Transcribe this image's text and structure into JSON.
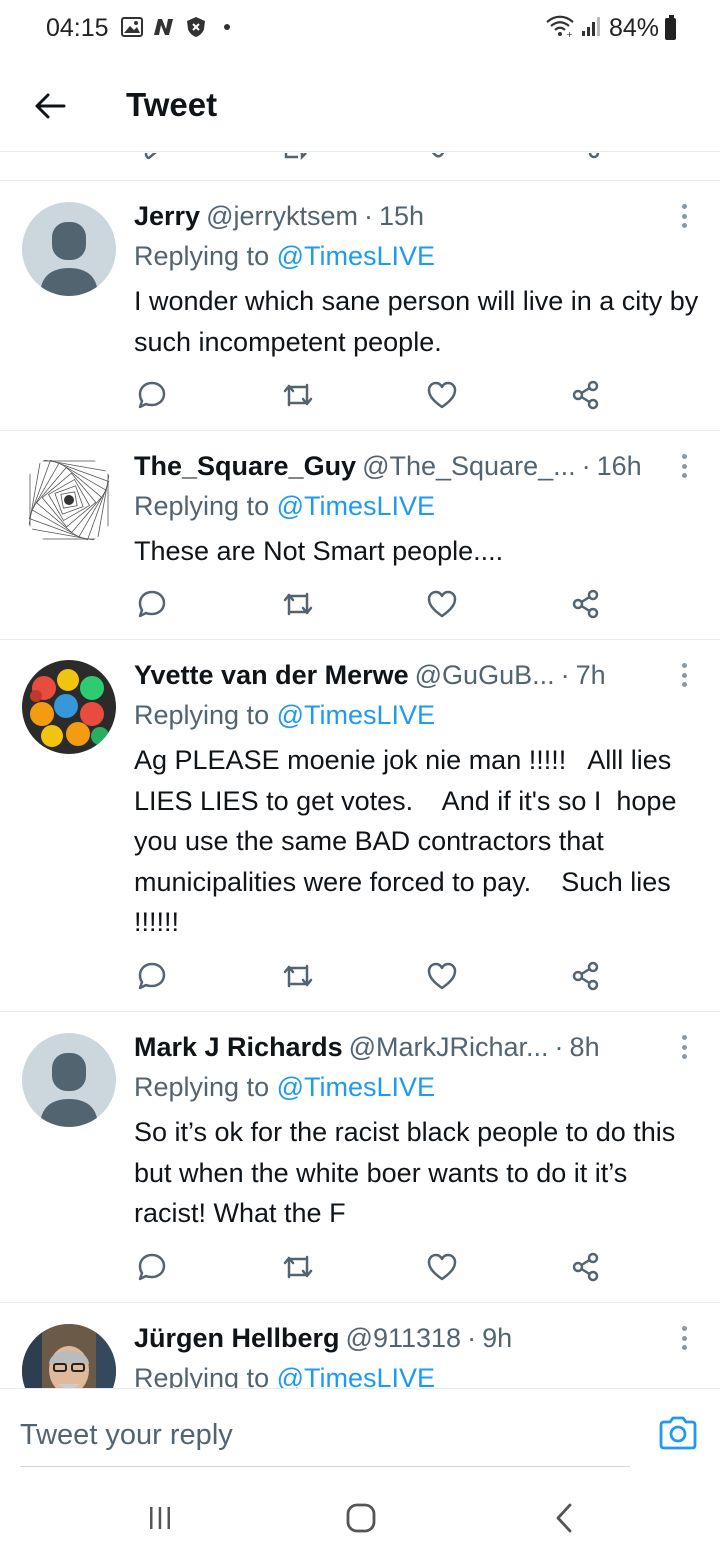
{
  "status_bar": {
    "time": "04:15",
    "battery": "84%",
    "icons_left": [
      "image-icon",
      "n-icon",
      "shield-icon"
    ],
    "icons_right": [
      "wifi-icon",
      "signal-icon",
      "battery-icon"
    ]
  },
  "header": {
    "title": "Tweet"
  },
  "tweets": [
    {
      "name": "Jerry",
      "handle": "@jerryktsem",
      "separator": "·",
      "time": "15h",
      "replying_prefix": "Replying to ",
      "replying_to": "@TimesLIVE",
      "text": "I wonder which sane person will live in a city by such incompetent people.",
      "avatar": "default-avatar"
    },
    {
      "name": "The_Square_Guy",
      "handle": "@The_Square_...",
      "separator": "·",
      "time": "16h",
      "replying_prefix": "Replying to ",
      "replying_to": "@TimesLIVE",
      "text": "These are Not Smart people....",
      "avatar": "spiral-avatar"
    },
    {
      "name": "Yvette van der Merwe",
      "handle": "@GuGuB...",
      "separator": "·",
      "time": "7h",
      "replying_prefix": "Replying to ",
      "replying_to": "@TimesLIVE",
      "text": "Ag PLEASE moenie jok nie man !!!!!   Alll lies LIES LIES to get votes.    And if it's so I  hope you use the same BAD contractors that municipalities were forced to pay.    Such lies !!!!!!",
      "avatar": "angry-birds-avatar"
    },
    {
      "name": "Mark J Richards",
      "handle": "@MarkJRichar...",
      "separator": "·",
      "time": "8h",
      "replying_prefix": "Replying to ",
      "replying_to": "@TimesLIVE",
      "text": "So it’s ok for the racist black people to do this but when the white boer wants to do it it’s racist! What the F",
      "avatar": "default-avatar"
    },
    {
      "name": "Jürgen Hellberg",
      "handle": "@911318",
      "separator": "·",
      "time": "9h",
      "replying_prefix": "Replying to ",
      "replying_to": "@TimesLIVE",
      "text": "",
      "avatar": "photo-avatar"
    }
  ],
  "composer": {
    "placeholder": "Tweet your reply"
  },
  "colors": {
    "accent": "#1d9bf0",
    "secondary_text": "#536471",
    "divider": "#e6ecf0"
  }
}
